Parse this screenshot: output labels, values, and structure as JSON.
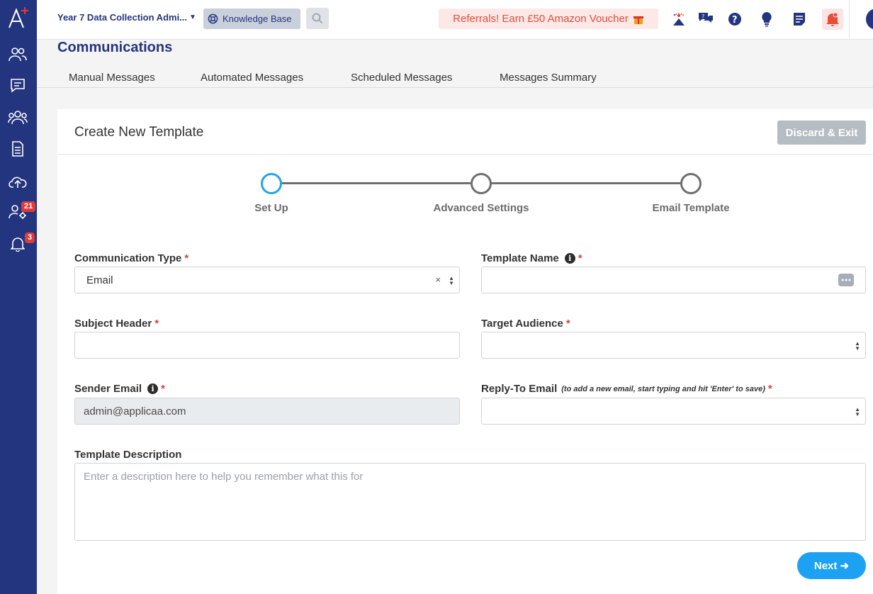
{
  "sidebar": {
    "badges": {
      "users_settings": "21",
      "notifications": "3"
    }
  },
  "topbar": {
    "project_name": "Year 7 Data Collection Admi...",
    "knowledge_base": "Knowledge Base",
    "referral": "Referrals! Earn £50 Amazon Voucher"
  },
  "page": {
    "title": "Communications",
    "tabs": [
      "Manual Messages",
      "Automated Messages",
      "Scheduled Messages",
      "Messages Summary"
    ]
  },
  "card": {
    "title": "Create New Template",
    "discard_label": "Discard & Exit",
    "steps": [
      "Set Up",
      "Advanced Settings",
      "Email Template"
    ],
    "active_step": 0
  },
  "form": {
    "communication_type": {
      "label": "Communication Type",
      "value": "Email"
    },
    "template_name": {
      "label": "Template Name",
      "value": ""
    },
    "subject_header": {
      "label": "Subject Header",
      "value": ""
    },
    "target_audience": {
      "label": "Target Audience",
      "value": ""
    },
    "sender_email": {
      "label": "Sender Email",
      "value": "admin@applicaa.com"
    },
    "reply_to_email": {
      "label": "Reply-To Email",
      "hint": "(to add a new email, start typing and hit 'Enter' to save)",
      "value": ""
    },
    "template_description": {
      "label": "Template Description",
      "placeholder": "Enter a description here to help you remember what this for"
    },
    "required_marker": "*",
    "next_label": "Next"
  },
  "colors": {
    "sidebar": "#24357f",
    "accent": "#1da1f2",
    "required": "#e03a3a"
  }
}
